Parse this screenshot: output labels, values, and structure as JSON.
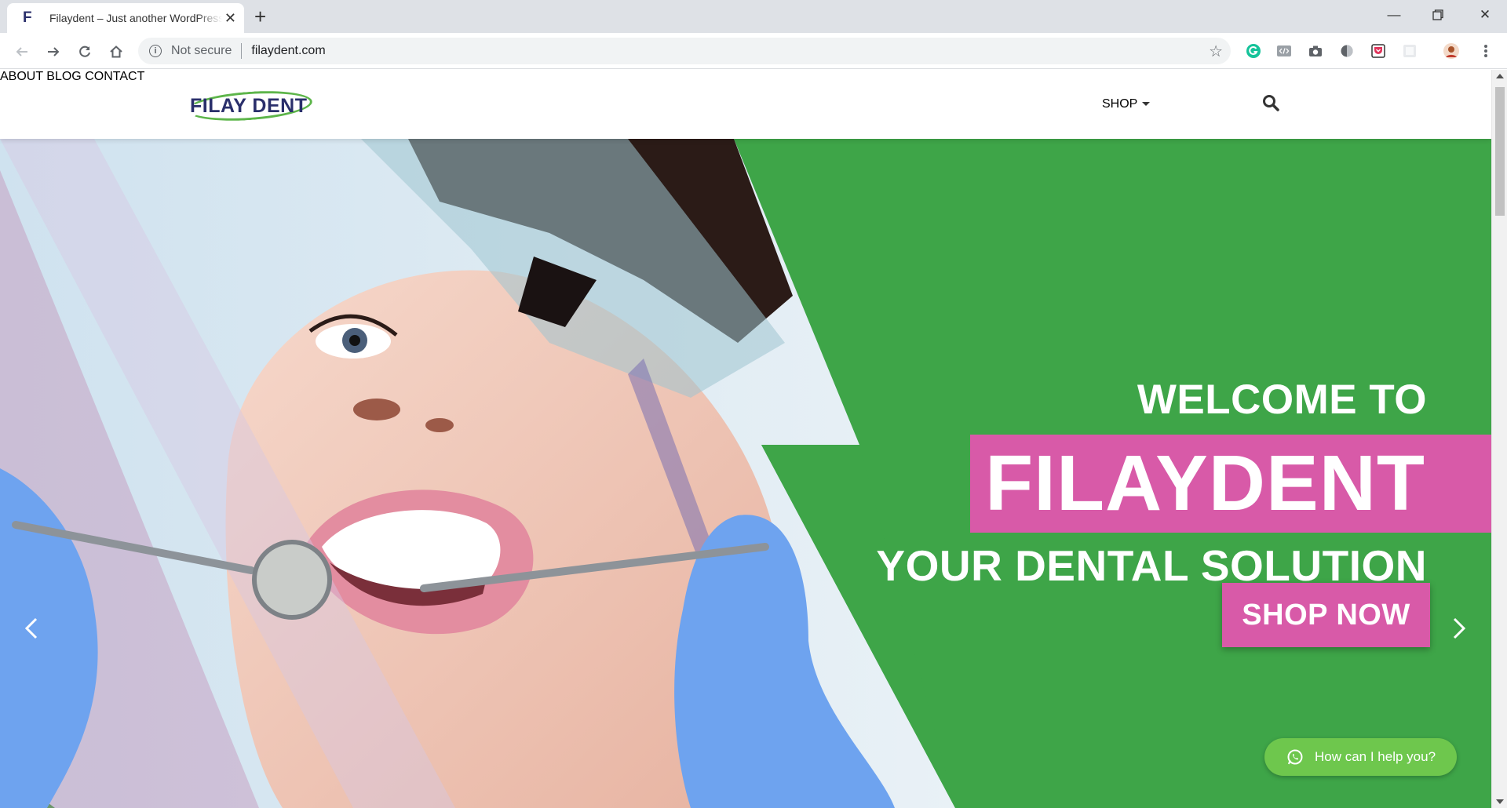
{
  "browser": {
    "tab": {
      "favicon": "F",
      "title": "Filaydent – Just another WordPress site"
    },
    "omnibox": {
      "security": "Not secure",
      "url": "filaydent.com"
    }
  },
  "site": {
    "logo": "FILAY DENT",
    "menu": [
      {
        "label": "ABOUT"
      },
      {
        "label": "BLOG"
      },
      {
        "label": "SHOP"
      },
      {
        "label": "CONTACT"
      }
    ]
  },
  "hero": {
    "welcome": "WELCOME TO",
    "brand": "FILAYDENT",
    "subtitle": "YOUR DENTAL SOLUTION",
    "cta": "SHOP NOW",
    "colors": {
      "green": "#3ea548",
      "pink": "#d85aa8"
    }
  },
  "chat": {
    "label": "How can I help you?"
  }
}
